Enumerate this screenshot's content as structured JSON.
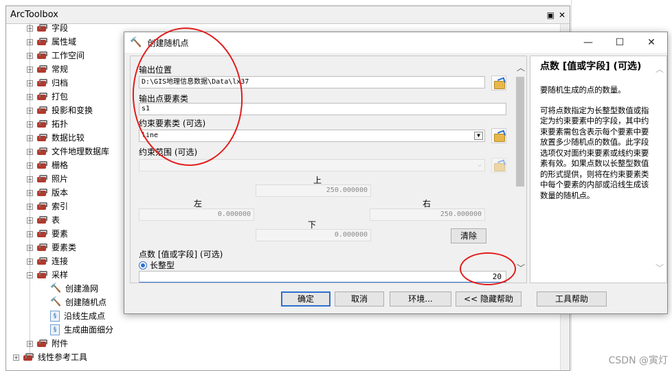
{
  "toolbox": {
    "title": "ArcToolbox",
    "title_controls": [
      "▣",
      "✕"
    ],
    "items": [
      {
        "label": "字段",
        "type": "toolset"
      },
      {
        "label": "属性域",
        "type": "toolset"
      },
      {
        "label": "工作空间",
        "type": "toolset"
      },
      {
        "label": "常规",
        "type": "toolset"
      },
      {
        "label": "归档",
        "type": "toolset"
      },
      {
        "label": "打包",
        "type": "toolset"
      },
      {
        "label": "投影和变换",
        "type": "toolset"
      },
      {
        "label": "拓扑",
        "type": "toolset"
      },
      {
        "label": "数据比较",
        "type": "toolset"
      },
      {
        "label": "文件地理数据库",
        "type": "toolset"
      },
      {
        "label": "栅格",
        "type": "toolset"
      },
      {
        "label": "照片",
        "type": "toolset"
      },
      {
        "label": "版本",
        "type": "toolset"
      },
      {
        "label": "索引",
        "type": "toolset"
      },
      {
        "label": "表",
        "type": "toolset"
      },
      {
        "label": "要素",
        "type": "toolset"
      },
      {
        "label": "要素类",
        "type": "toolset"
      },
      {
        "label": "连接",
        "type": "toolset"
      },
      {
        "label": "采样",
        "type": "toolset-open"
      },
      {
        "label": "创建渔网",
        "type": "tool"
      },
      {
        "label": "创建随机点",
        "type": "tool"
      },
      {
        "label": "沿线生成点",
        "type": "script"
      },
      {
        "label": "生成曲面细分",
        "type": "script"
      },
      {
        "label": "附件",
        "type": "toolset"
      },
      {
        "label": "线性参考工具",
        "type": "toolbox"
      }
    ]
  },
  "dialog": {
    "title": "创建随机点",
    "window_buttons": [
      "—",
      "☐",
      "✕"
    ],
    "output_location": {
      "label": "输出位置",
      "value": "D:\\GIS地理信息数据\\Data\\lx37"
    },
    "output_fc": {
      "label": "输出点要素类",
      "value": "s1"
    },
    "constraint_fc": {
      "label": "约束要素类 (可选)",
      "value": "line"
    },
    "constraint_extent": {
      "label": "约束范围 (可选)",
      "value": ""
    },
    "extent": {
      "top_label": "上",
      "top_value": "250.000000",
      "left_label": "左",
      "left_value": "0.000000",
      "right_label": "右",
      "right_value": "250.000000",
      "bottom_label": "下",
      "bottom_value": "0.000000",
      "clear_label": "清除"
    },
    "count": {
      "label": "点数 [值或字段] (可选)",
      "radio_label": "长整型",
      "value": "20"
    },
    "buttons": {
      "ok": "确定",
      "cancel": "取消",
      "env": "环境...",
      "hide_help": "<< 隐藏帮助",
      "tool_help": "工具帮助"
    }
  },
  "help": {
    "title": "点数 [值或字段] (可选)",
    "paragraphs": [
      "要随机生成的点的数量。",
      "可将点数指定为长整型数值或指定为约束要素中的字段，其中约束要素需包含表示每个要素中要放置多少随机点的数值。此字段选项仅对面约束要素或线约束要素有效。如果点数以长整型数值的形式提供，则将在约束要素类中每个要素的内部或沿线生成该数量的随机点。"
    ]
  },
  "watermark": "CSDN @寅灯",
  "annotation_color": "#e31b1b",
  "accent_color": "#2f6fcf"
}
